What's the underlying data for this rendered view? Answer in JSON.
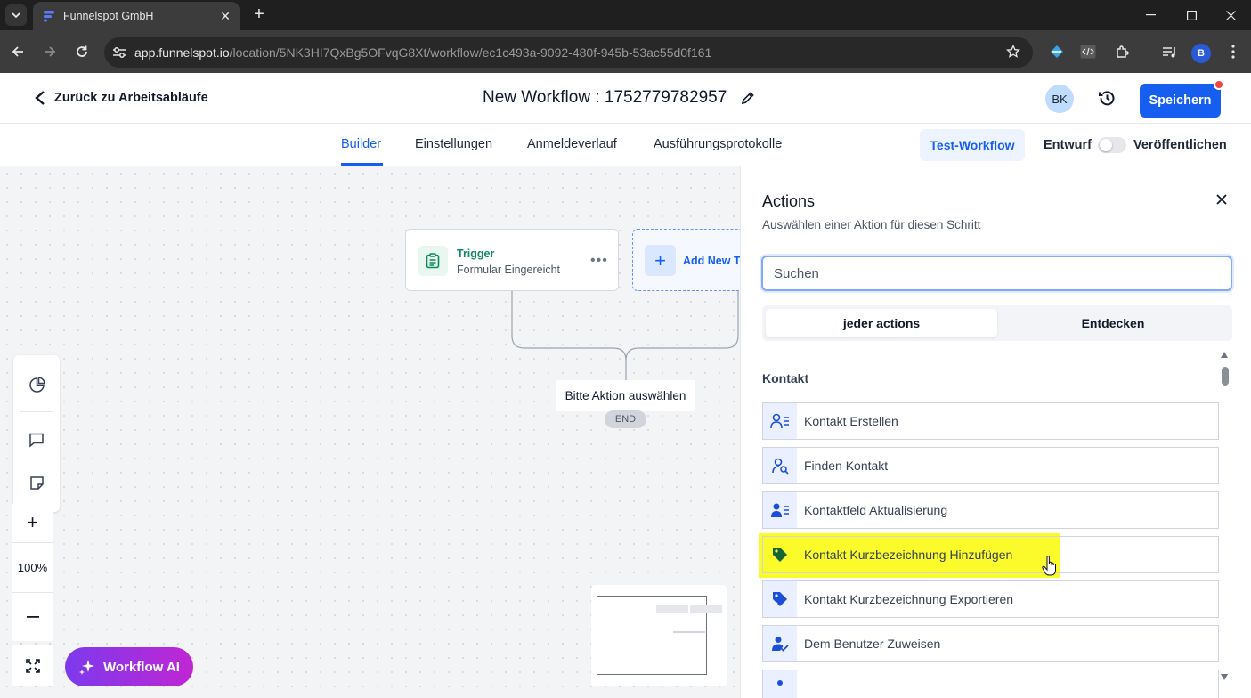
{
  "browser": {
    "tab_title": "Funnelspot GmbH",
    "url_domain": "app.funnelspot.io",
    "url_path": "/location/5NK3HI7QxBg5OFvqG8Xt/workflow/ec1c493a-9092-480f-945b-53ac55d0f161",
    "profile_initial": "B"
  },
  "header": {
    "back_label": "Zurück zu Arbeitsabläufe",
    "workflow_title": "New Workflow : 1752779782957",
    "avatar_initials": "BK",
    "save_label": "Speichern"
  },
  "tabs": {
    "items": [
      "Builder",
      "Einstellungen",
      "Anmeldeverlauf",
      "Ausführungsprotokolle"
    ],
    "active": "Builder",
    "test_label": "Test-Workflow",
    "draft_label": "Entwurf",
    "publish_label": "Veröffentlichen",
    "publish_toggle_on": false
  },
  "canvas": {
    "trigger_title": "Trigger",
    "trigger_subtitle": "Formular Eingereicht",
    "add_trigger_label": "Add New Tr",
    "action_placeholder": "Bitte Aktion auswählen",
    "end_label": "END",
    "zoom_level": "100%",
    "ai_button": "Workflow AI"
  },
  "panel": {
    "title": "Actions",
    "subtitle": "Auswählen einer Aktion für diesen Schritt",
    "search_placeholder": "Suchen",
    "segments": [
      "jeder actions",
      "Entdecken"
    ],
    "active_segment": "jeder actions",
    "section_label": "Kontakt",
    "highlight_color": "#fbfb2c",
    "items": [
      {
        "label": "Kontakt Erstellen",
        "icon": "user-list-icon"
      },
      {
        "label": "Finden Kontakt",
        "icon": "user-search-icon"
      },
      {
        "label": "Kontaktfeld Aktualisierung",
        "icon": "user-edit-icon"
      },
      {
        "label": "Kontakt Kurzbezeichnung Hinzufügen",
        "icon": "tag-icon",
        "highlighted": true
      },
      {
        "label": "Kontakt Kurzbezeichnung Exportieren",
        "icon": "tag-remove-icon"
      },
      {
        "label": "Dem Benutzer Zuweisen",
        "icon": "user-check-icon"
      }
    ]
  },
  "colors": {
    "primary": "#155eef",
    "trigger_green": "#0f8a5f",
    "notification_dot": "#ef4444"
  }
}
